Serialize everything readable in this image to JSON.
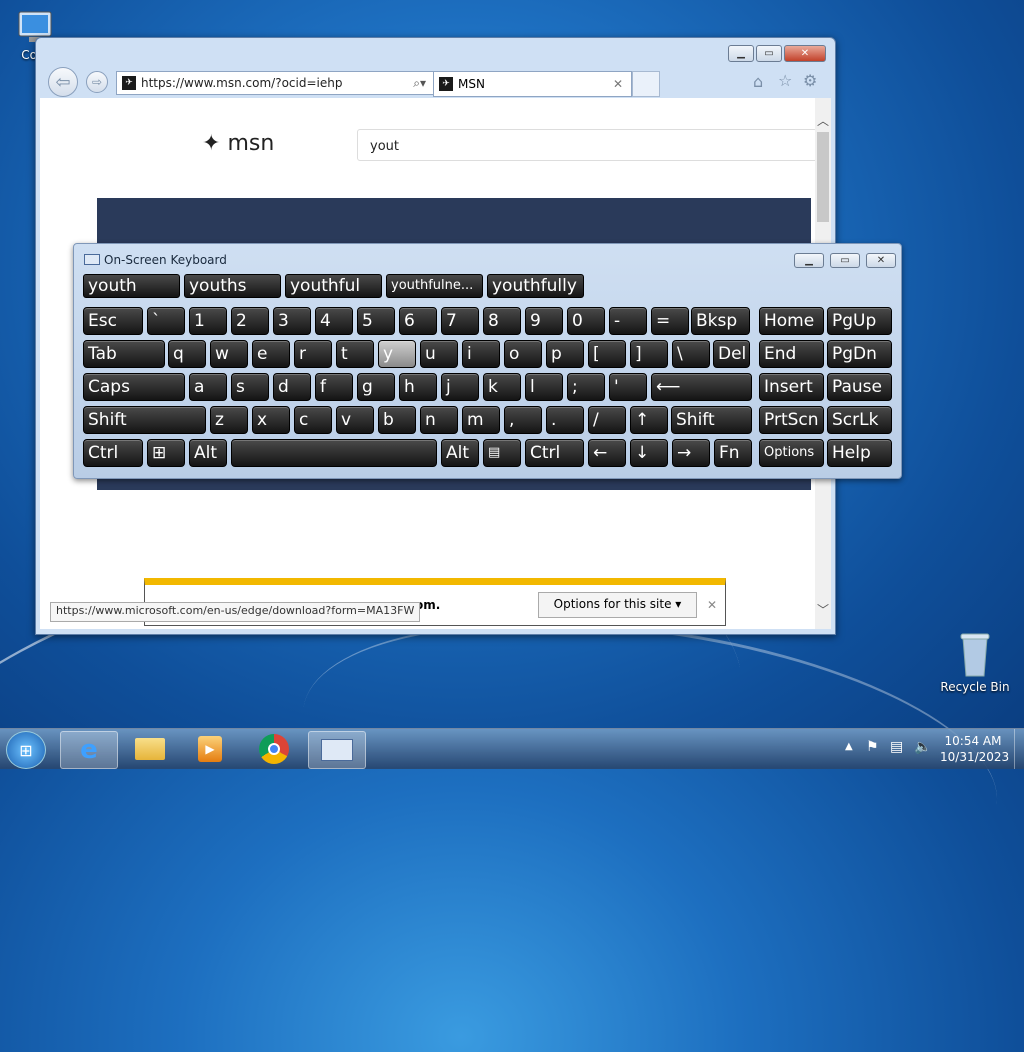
{
  "desktop": {
    "computer_label": "Com",
    "recycle_bin_label": "Recycle Bin"
  },
  "browser": {
    "address": "https://www.msn.com/?ocid=iehp",
    "tab_title": "MSN",
    "logo_text": "msn",
    "search_value": "yout",
    "status_url": "https://www.microsoft.com/en-us/edge/download?form=MA13FW",
    "notification_text": "om.",
    "options_button": "Options for this site"
  },
  "osk": {
    "title": "On-Screen Keyboard",
    "suggestions": [
      "youth",
      "youths",
      "youthful",
      "youthfulne...",
      "youthfully"
    ],
    "keys": {
      "esc": "Esc",
      "bksp": "Bksp",
      "home": "Home",
      "pgup": "PgUp",
      "tab": "Tab",
      "del": "Del",
      "end": "End",
      "pgdn": "PgDn",
      "caps": "Caps",
      "insert": "Insert",
      "pause": "Pause",
      "shift": "Shift",
      "prtscn": "PrtScn",
      "scrlk": "ScrLk",
      "ctrl": "Ctrl",
      "alt": "Alt",
      "fn": "Fn",
      "options": "Options",
      "help": "Help"
    },
    "row1": [
      [
        "~",
        "`"
      ],
      [
        "!",
        "1"
      ],
      [
        "@",
        "2"
      ],
      [
        "#",
        "3"
      ],
      [
        "$",
        "4"
      ],
      [
        "%",
        "5"
      ],
      [
        "^",
        "6"
      ],
      [
        "&",
        "7"
      ],
      [
        "*",
        "8"
      ],
      [
        "(",
        "9"
      ],
      [
        ")",
        "0"
      ],
      [
        "_",
        "-"
      ],
      [
        "+",
        "="
      ]
    ],
    "row2": [
      "q",
      "w",
      "e",
      "r",
      "t",
      "y",
      "u",
      "i",
      "o",
      "p",
      [
        "{",
        "["
      ],
      [
        "}",
        "]"
      ],
      [
        "|",
        "\\"
      ]
    ],
    "row3": [
      "a",
      "s",
      "d",
      "f",
      "g",
      "h",
      "j",
      "k",
      "l",
      [
        ":",
        ";"
      ],
      [
        "\"",
        "'"
      ]
    ],
    "row4": [
      "z",
      "x",
      "c",
      "v",
      "b",
      "n",
      "m",
      [
        "<",
        ","
      ],
      [
        ">",
        "."
      ],
      [
        "?",
        "/"
      ]
    ]
  },
  "tray": {
    "time": "10:54 AM",
    "date": "10/31/2023"
  }
}
